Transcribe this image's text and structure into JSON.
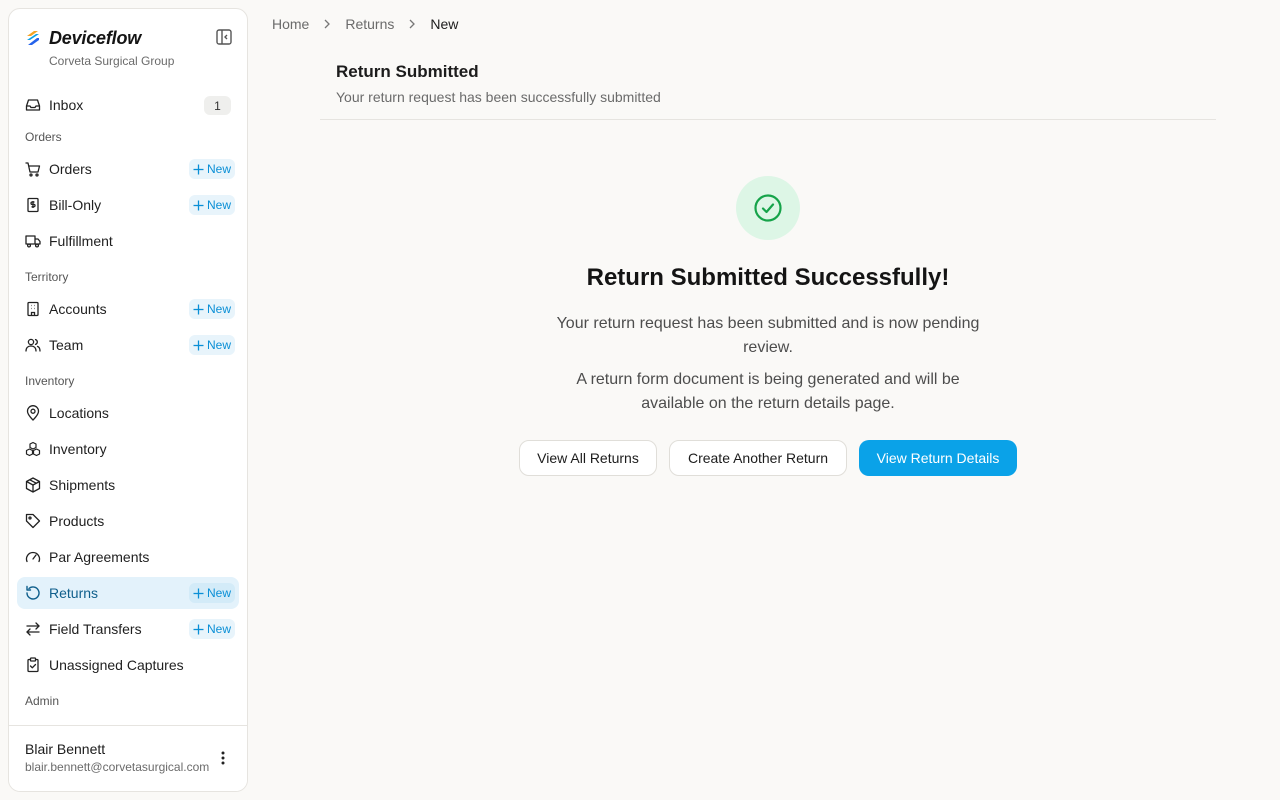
{
  "app": {
    "brand": "Deviceflow",
    "org": "Corveta Surgical Group"
  },
  "sidebar": {
    "inbox": {
      "label": "Inbox",
      "count": "1"
    },
    "sections": {
      "orders": "Orders",
      "territory": "Territory",
      "inventory": "Inventory",
      "admin": "Admin"
    },
    "new_label": "New",
    "items": {
      "orders": "Orders",
      "bill_only": "Bill-Only",
      "fulfillment": "Fulfillment",
      "accounts": "Accounts",
      "team": "Team",
      "locations": "Locations",
      "inventory": "Inventory",
      "shipments": "Shipments",
      "products": "Products",
      "par_agreements": "Par Agreements",
      "returns": "Returns",
      "field_transfers": "Field Transfers",
      "unassigned_captures": "Unassigned Captures"
    },
    "active_item": "Returns"
  },
  "user": {
    "name": "Blair Bennett",
    "email": "blair.bennett@corvetasurgical.com"
  },
  "breadcrumb": [
    "Home",
    "Returns",
    "New"
  ],
  "page": {
    "title": "Return Submitted",
    "subtitle": "Your return request has been successfully submitted"
  },
  "success": {
    "title": "Return Submitted Successfully!",
    "message1": "Your return request has been submitted and is now pending review.",
    "message2": "A return form document is being generated and will be available on the return details page."
  },
  "actions": {
    "view_all": "View All Returns",
    "create_another": "Create Another Return",
    "view_details": "View Return Details"
  },
  "colors": {
    "accent": "#0aa2e8",
    "active_bg": "#e3f2fb",
    "success_bg": "#ddf6e6",
    "success_icon": "#16a34a"
  }
}
